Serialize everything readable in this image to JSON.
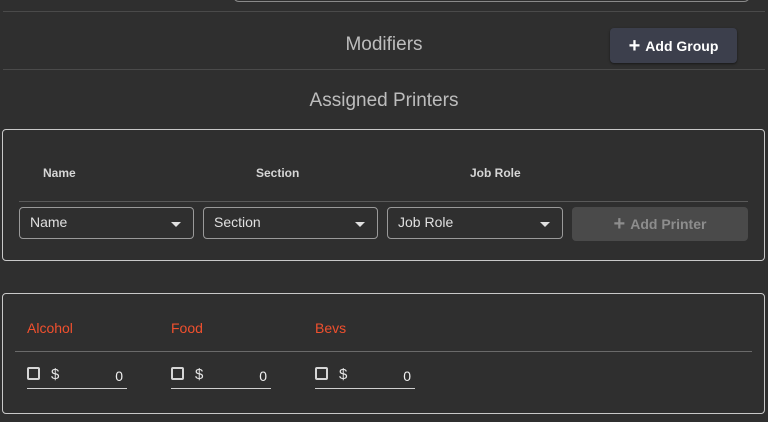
{
  "modifiers": {
    "title": "Modifiers",
    "add_group_label": "Add Group"
  },
  "assigned_printers": {
    "title": "Assigned Printers",
    "columns": [
      "Name",
      "Section",
      "Job Role"
    ],
    "selects": {
      "name": "Name",
      "section": "Section",
      "job_role": "Job Role"
    },
    "add_printer_label": "Add Printer"
  },
  "categories": [
    {
      "name": "Alcohol",
      "currency": "$",
      "amount": "0"
    },
    {
      "name": "Food",
      "currency": "$",
      "amount": "0"
    },
    {
      "name": "Bevs",
      "currency": "$",
      "amount": "0"
    }
  ],
  "colors": {
    "accent": "#f0502e",
    "background": "#2f2f2f",
    "button": "#3c3f4c"
  }
}
